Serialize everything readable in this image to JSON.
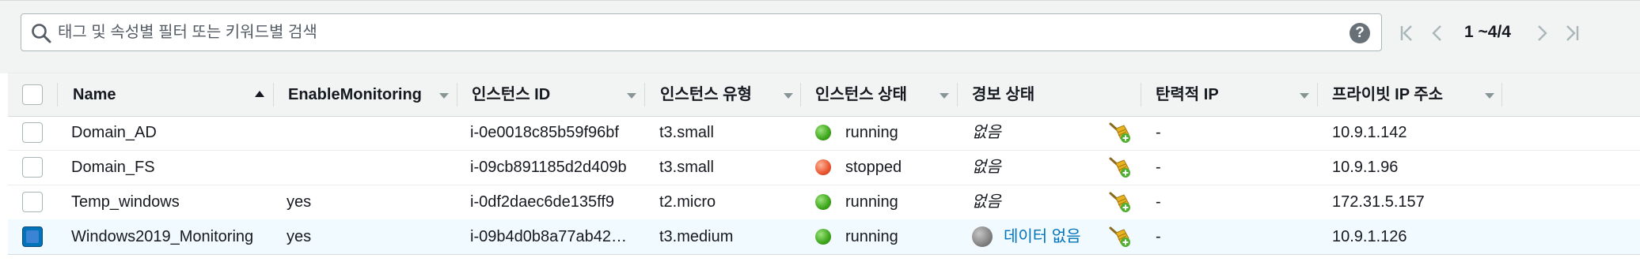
{
  "search": {
    "placeholder": "태그 및 속성별 필터 또는 키워드별 검색",
    "pagination": "1 ~4/4"
  },
  "columns": {
    "name": "Name",
    "enable_monitoring": "EnableMonitoring",
    "instance_id": "인스턴스 ID",
    "instance_type": "인스턴스 유형",
    "instance_state": "인스턴스 상태",
    "alarm_state": "경보 상태",
    "elastic_ip": "탄력적 IP",
    "private_ip": "프라이빗 IP 주소"
  },
  "rows": [
    {
      "name": "Domain_AD",
      "enable_monitoring": "",
      "instance_id": "i-0e0018c85b59f96bf",
      "instance_type": "t3.small",
      "state": "running",
      "state_color": "green",
      "alarm": "없음",
      "elastic_ip": "-",
      "private_ip": "10.9.1.142",
      "selected": false
    },
    {
      "name": "Domain_FS",
      "enable_monitoring": "",
      "instance_id": "i-09cb891185d2d409b",
      "instance_type": "t3.small",
      "state": "stopped",
      "state_color": "red",
      "alarm": "없음",
      "elastic_ip": "-",
      "private_ip": "10.9.1.96",
      "selected": false
    },
    {
      "name": "Temp_windows",
      "enable_monitoring": "yes",
      "instance_id": "i-0df2daec6de135ff9",
      "instance_type": "t2.micro",
      "state": "running",
      "state_color": "green",
      "alarm": "없음",
      "elastic_ip": "-",
      "private_ip": "172.31.5.157",
      "selected": false
    },
    {
      "name": "Windows2019_Monitoring",
      "enable_monitoring": "yes",
      "instance_id": "i-09b4d0b8a77ab42…",
      "instance_type": "t3.medium",
      "state": "running",
      "state_color": "green",
      "alarm": "데이터 없음",
      "elastic_ip": "-",
      "private_ip": "10.9.1.126",
      "selected": true
    }
  ],
  "colors": {
    "accent": "#0073bb",
    "running": "#3ea51b",
    "stopped": "#e9552f"
  },
  "icons": {
    "search": "search-icon",
    "help": "help-icon",
    "first": "first-page-icon",
    "prev": "prev-page-icon",
    "next": "next-page-icon",
    "last": "last-page-icon",
    "alarm": "add-alarm-icon"
  }
}
